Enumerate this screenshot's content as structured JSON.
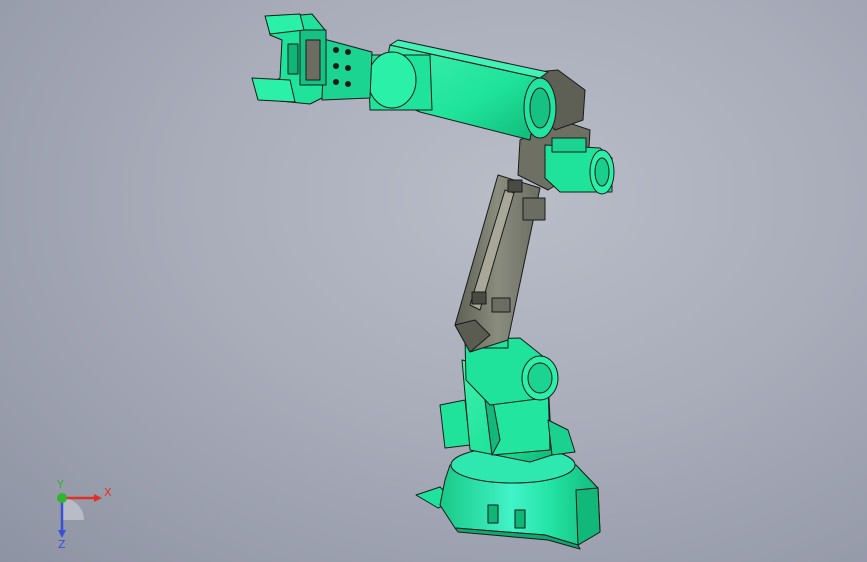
{
  "viewport": {
    "model": "robot-arm-6-axis",
    "colors": {
      "part_green": "#1fe39a",
      "part_green_dark": "#0fb676",
      "part_gray": "#7d7f72",
      "part_gray_dark": "#4a4c44",
      "edge": "#1a1a1a"
    }
  },
  "triad": {
    "x_label": "X",
    "y_label": "Y",
    "z_label": "Z",
    "colors": {
      "x": "#e0302a",
      "y": "#2fb52f",
      "z": "#3a4fd8"
    }
  }
}
